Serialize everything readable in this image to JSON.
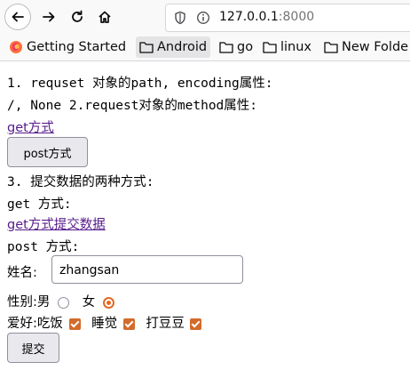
{
  "browser": {
    "url_host": "127.0.0.1",
    "url_port": ":8000"
  },
  "bookmarks": [
    {
      "label": "Getting Started",
      "icon": "firefox-icon"
    },
    {
      "label": "Android",
      "icon": "folder-icon"
    },
    {
      "label": "go",
      "icon": "folder-icon"
    },
    {
      "label": "linux",
      "icon": "folder-icon"
    },
    {
      "label": "New Folde",
      "icon": "folder-icon"
    }
  ],
  "content": {
    "line1": "1. requset 对象的path, encoding属性:",
    "line2": "/, None 2.request对象的method属性:",
    "get_link": "get方式",
    "post_button": "post方式",
    "line3": "3. 提交数据的两种方式:",
    "get_heading": "get 方式:",
    "get_submit_link": "get方式提交数据",
    "post_heading": "post 方式:"
  },
  "form": {
    "name_label": "姓名:",
    "name_value": "zhangsan",
    "gender_label": "性别:",
    "gender_male": "男",
    "gender_female": "女",
    "gender_selected": "女",
    "hobby_label": "爱好:",
    "hobbies": [
      {
        "label": "吃饭",
        "checked": true
      },
      {
        "label": "睡觉",
        "checked": true
      },
      {
        "label": "打豆豆",
        "checked": true
      }
    ],
    "submit_label": "提交"
  },
  "colors": {
    "accent": "#e06a26",
    "visited_link": "#551a8b"
  }
}
